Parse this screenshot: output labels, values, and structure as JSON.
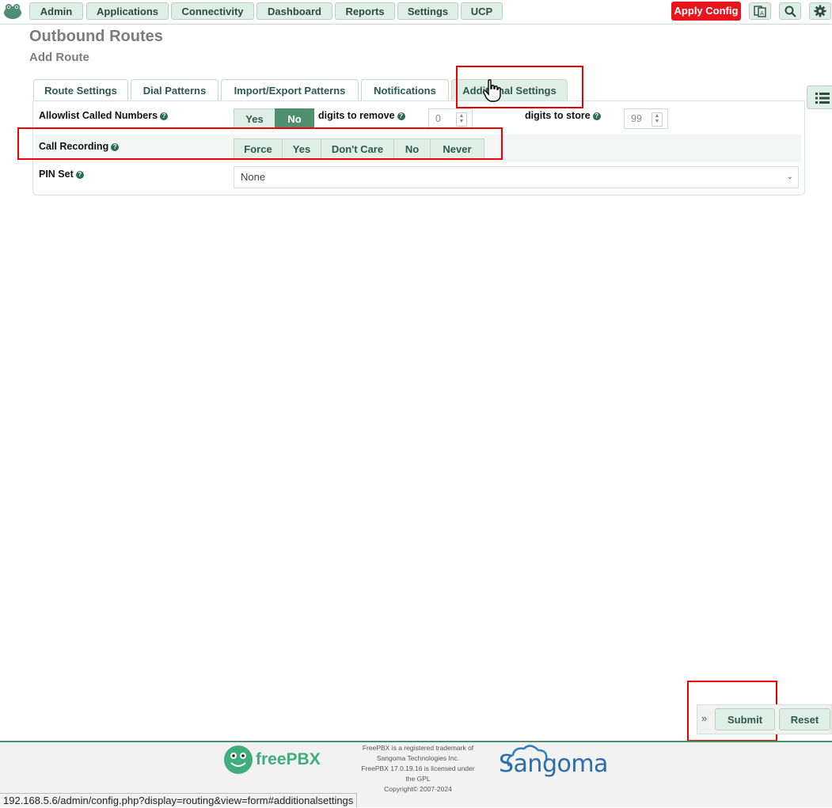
{
  "topnav": {
    "items": [
      "Admin",
      "Applications",
      "Connectivity",
      "Dashboard",
      "Reports",
      "Settings",
      "UCP"
    ],
    "apply_config": "Apply Config",
    "icons": [
      "language-icon",
      "search-icon",
      "gear-icon"
    ]
  },
  "page": {
    "title": "Outbound Routes",
    "subtitle": "Add Route"
  },
  "tabs": [
    "Route Settings",
    "Dial Patterns",
    "Import/Export Patterns",
    "Notifications",
    "Additional Settings"
  ],
  "active_tab": "Additional Settings",
  "form": {
    "allowlist": {
      "label": "Allowlist Called Numbers",
      "options": [
        "Yes",
        "No"
      ],
      "selected": "No",
      "digits_remove_label": "digits to remove",
      "digits_remove_value": "0",
      "digits_store_label": "digits to store",
      "digits_store_value": "99"
    },
    "call_recording": {
      "label": "Call Recording",
      "options": [
        "Force",
        "Yes",
        "Don't Care",
        "No",
        "Never"
      ]
    },
    "pin_set": {
      "label": "PIN Set",
      "value": "None"
    }
  },
  "actions": {
    "submit": "Submit",
    "reset": "Reset"
  },
  "footer": {
    "freepbx_logo": "freePBX",
    "sangoma_logo": "Sangoma",
    "lines": [
      "FreePBX is a registered trademark of",
      "Sangoma Technologies Inc.",
      "FreePBX 17.0.19.16 is licensed under",
      "the GPL",
      "Copyright© 2007-2024"
    ]
  },
  "status_url": "192.168.5.6/admin/config.php?display=routing&view=form#additionalsettings",
  "colors": {
    "accent": "#4d8f6e",
    "apply": "#e8161c",
    "highlight": "#ee0000"
  }
}
